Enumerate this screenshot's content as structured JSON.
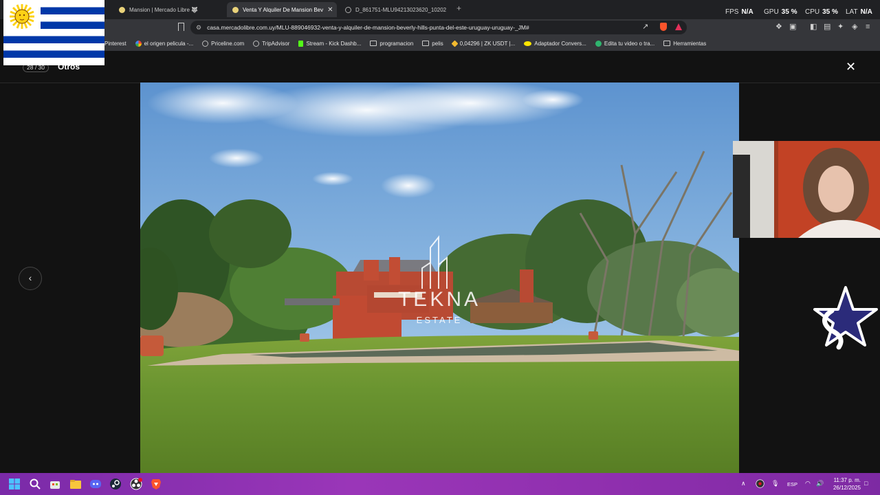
{
  "browser": {
    "tabs": [
      {
        "title": "Mansion | Mercado Libre 🐺",
        "active": false
      },
      {
        "title": "Venta Y Alquiler De Mansion Bev",
        "active": true
      },
      {
        "title": "D_861751-MLU94213023620_10202",
        "active": false
      }
    ],
    "new_tab": "+",
    "close_glyph": "✕",
    "url": "casa.mercadolibre.com.uy/MLU-889046932-venta-y-alquiler-de-mansion-beverly-hills-punta-del-este-uruguay-uruguay-_JM#",
    "bookmarks": [
      {
        "label": "Pinterest",
        "icon": "pinterest-icon",
        "color": "#e60023"
      },
      {
        "label": "el origen pelicula -...",
        "icon": "google-icon",
        "color": "#4285f4"
      },
      {
        "label": "Priceline.com",
        "icon": "globe-icon",
        "color": "#888888"
      },
      {
        "label": "TripAdvisor",
        "icon": "globe-icon",
        "color": "#888888"
      },
      {
        "label": "Stream - Kick Dashb...",
        "icon": "kick-icon",
        "color": "#53fc18"
      },
      {
        "label": "programacion",
        "icon": "folder-icon",
        "color": ""
      },
      {
        "label": "pelis",
        "icon": "folder-icon",
        "color": ""
      },
      {
        "label": "0,04296 | ZK USDT |...",
        "icon": "binance-icon",
        "color": "#f3ba2f"
      },
      {
        "label": "Adaptador Convers...",
        "icon": "mercadolibre-icon",
        "color": "#ffe600"
      },
      {
        "label": "Edita tu video o tra...",
        "icon": "clipchamp-icon",
        "color": "#2fb46e"
      },
      {
        "label": "Herramientas",
        "icon": "folder-icon",
        "color": ""
      }
    ]
  },
  "overlay_stats": {
    "fps_label": "FPS",
    "fps_value": "N/A",
    "gpu_label": "GPU",
    "gpu_value": "35 %",
    "cpu_label": "CPU",
    "cpu_value": "35 %",
    "lat_label": "LAT",
    "lat_value": "N/A"
  },
  "gallery": {
    "counter": "28 / 30",
    "title": "Otros",
    "close_glyph": "✕",
    "prev_glyph": "‹",
    "watermark_brand": "TEKNA",
    "watermark_sub": "ESTATE"
  },
  "taskbar": {
    "language": "ESP",
    "time": "11:37 p. m.",
    "date": "26/12/2025",
    "tray_up": "∧"
  },
  "colors": {
    "taskbar": "#8f2fae",
    "chrome_dark": "#202124",
    "chrome_mid": "#35363a",
    "page_bg": "#121212"
  }
}
